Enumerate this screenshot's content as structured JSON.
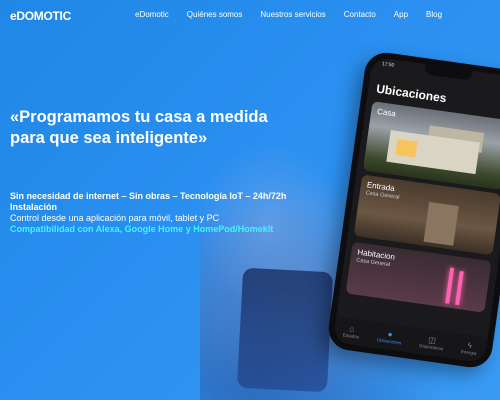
{
  "nav": {
    "logo": "eDOMOTIC",
    "links": [
      "eDomotic",
      "Quiénes somos",
      "Nuestros servicios",
      "Contacto",
      "App",
      "Blog"
    ]
  },
  "hero": {
    "title": "«Programamos tu casa a medida para que sea inteligente»",
    "feature_line1": "Sin necesidad de internet –  Sin obras – Tecnología IoT – 24h/72h",
    "feature_line2": "Instalación",
    "feature_line3": "Control desde una aplicación para móvil, tablet y PC",
    "feature_line4": "Compatibilidad con Alexa, Google Home y HomePod/Homekit"
  },
  "phone": {
    "status_time": "17:50",
    "app_title": "Ubicaciones",
    "cards": [
      {
        "label": "Casa",
        "sub": ""
      },
      {
        "label": "Entrada",
        "sub": "Casa General"
      },
      {
        "label": "Habitacion",
        "sub": "Casa General"
      }
    ],
    "tabs": [
      "Estados",
      "Ubicaciones",
      "Dispositivos",
      "Energia"
    ],
    "active_tab": "Ubicaciones"
  },
  "colors": {
    "background": "#2a8ff0",
    "accent_cyan": "#3ff6ff",
    "phone_body": "#0d0d10"
  }
}
